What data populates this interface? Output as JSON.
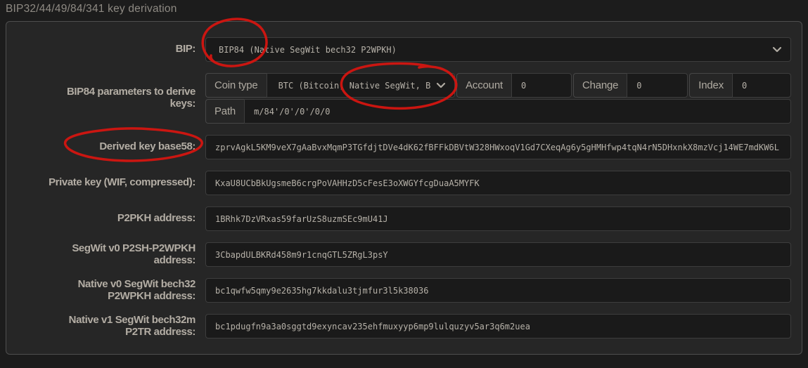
{
  "window": {
    "title": "BIP32/44/49/84/341 key derivation"
  },
  "form": {
    "bip_row": {
      "label": "BIP:",
      "select_value": "BIP84 (Native SegWit bech32 P2WPKH)"
    },
    "params_row": {
      "label": "BIP84 parameters to derive keys:",
      "coin_type": {
        "label": "Coin type",
        "select_value": "BTC (Bitcoin, Native SegWit, B"
      },
      "account": {
        "label": "Account",
        "value": "0"
      },
      "change": {
        "label": "Change",
        "value": "0"
      },
      "index": {
        "label": "Index",
        "value": "0"
      },
      "path": {
        "label": "Path",
        "value": "m/84'/0'/0'/0/0"
      }
    },
    "fields": [
      {
        "label": "Derived key base58:",
        "value": "zprvAgkL5KM9veX7gAaBvxMqmP3TGfdjtDVe4dK62fBFFkDBVtW328HWxoqV1Gd7CXeqAg6y5gHMHfwp4tqN4rN5DHxnkX8mzVcj14WE7mdKW6L"
      },
      {
        "label": "Private key (WIF, compressed):",
        "value": "KxaU8UCbBkUgsmeB6crgPoVAHHzD5cFesE3oXWGYfcgDuaA5MYFK"
      },
      {
        "label": "P2PKH address:",
        "value": "1BRhk7DzVRxas59farUzS8uzmSEc9mU41J"
      },
      {
        "label": "SegWit v0 P2SH-P2WPKH address:",
        "value": "3CbapdULBKRd458m9r1cnqGTL5ZRgL3psY"
      },
      {
        "label": "Native v0 SegWit bech32 P2WPKH address:",
        "value": "bc1qwfw5qmy9e2635hg7kkdalu3tjmfur3l5k38036"
      },
      {
        "label": "Native v1 SegWit bech32m P2TR address:",
        "value": "bc1pdugfn9a3a0sggtd9exyncav235ehfmuxyyp6mp9lulquzyv5ar3q6m2uea"
      }
    ]
  },
  "icons": {
    "bip_select": "chevron-down",
    "coin_select": "chevron-down"
  },
  "annotations": {
    "color": "#d41510",
    "items": [
      {
        "shape": "hand-drawn-ellipse",
        "around": "BIP84 text in BIP select"
      },
      {
        "shape": "hand-drawn-ellipse",
        "around": "Native SegWit text in coin type select"
      },
      {
        "shape": "hand-drawn-ellipse",
        "around": "Derived key base58 label"
      }
    ]
  },
  "colors": {
    "background": "#1c1c1c",
    "panel": "#262626",
    "panel_border": "#4f4f4f",
    "field_background": "#1a1a1a",
    "field_border": "#3d3d3d",
    "label_text": "#b3ada4",
    "value_text": "#b6b1a8",
    "title_text": "#8e8a83",
    "annotation_red": "#d41510"
  }
}
